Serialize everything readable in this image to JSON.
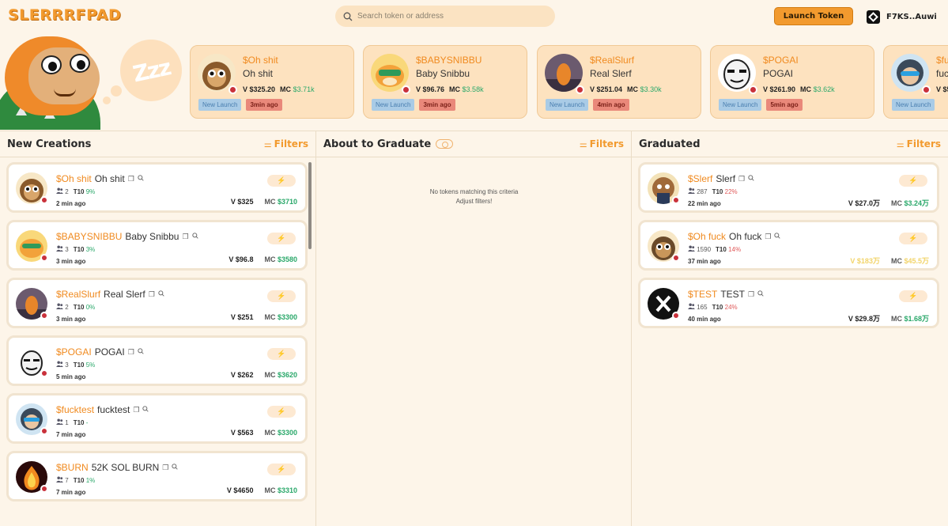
{
  "header": {
    "logo": "SLERRRFPAD",
    "search_placeholder": "Search token or address",
    "launch_label": "Launch Token",
    "wallet_label": "F7KS..Auwi"
  },
  "banner": {
    "zzz": "Zzz",
    "cards": [
      {
        "ticker": "$Oh shit",
        "name": "Oh shit",
        "vol": "V $325.20",
        "mc_label": "MC",
        "mc": "$3.71k",
        "tag": "New Launch",
        "time": "3min ago"
      },
      {
        "ticker": "$BABYSNIBBU",
        "name": "Baby Snibbu",
        "vol": "V $96.76",
        "mc_label": "MC",
        "mc": "$3.58k",
        "tag": "New Launch",
        "time": "3min ago"
      },
      {
        "ticker": "$RealSlurf",
        "name": "Real Slerf",
        "vol": "V $251.04",
        "mc_label": "MC",
        "mc": "$3.30k",
        "tag": "New Launch",
        "time": "4min ago"
      },
      {
        "ticker": "$POGAI",
        "name": "POGAI",
        "vol": "V $261.90",
        "mc_label": "MC",
        "mc": "$3.62k",
        "tag": "New Launch",
        "time": "5min ago"
      },
      {
        "ticker": "$fu",
        "name": "fuc",
        "vol": "V $5",
        "mc_label": "",
        "mc": "",
        "tag": "New Launch",
        "time": ""
      }
    ]
  },
  "columns": {
    "new": {
      "title": "New Creations",
      "filters": "Filters",
      "rows": [
        {
          "ticker": "$Oh shit",
          "name": "Oh shit",
          "holders": "2",
          "t10_label": "T10",
          "t10": "9%",
          "time": "2 min ago",
          "vol": "V $325",
          "mc_label": "MC",
          "mc": "$3710"
        },
        {
          "ticker": "$BABYSNIBBU",
          "name": "Baby Snibbu",
          "holders": "3",
          "t10_label": "T10",
          "t10": "3%",
          "time": "3 min ago",
          "vol": "V $96.8",
          "mc_label": "MC",
          "mc": "$3580"
        },
        {
          "ticker": "$RealSlurf",
          "name": "Real Slerf",
          "holders": "2",
          "t10_label": "T10",
          "t10": "0%",
          "time": "3 min ago",
          "vol": "V $251",
          "mc_label": "MC",
          "mc": "$3300"
        },
        {
          "ticker": "$POGAI",
          "name": "POGAI",
          "holders": "3",
          "t10_label": "T10",
          "t10": "5%",
          "time": "5 min ago",
          "vol": "V $262",
          "mc_label": "MC",
          "mc": "$3620"
        },
        {
          "ticker": "$fucktest",
          "name": "fucktest",
          "holders": "1",
          "t10_label": "T10",
          "t10": "-",
          "time": "7 min ago",
          "vol": "V $563",
          "mc_label": "MC",
          "mc": "$3300"
        },
        {
          "ticker": "$BURN",
          "name": "52K SOL BURN",
          "holders": "7",
          "t10_label": "T10",
          "t10": "1%",
          "time": "7 min ago",
          "vol": "V $4650",
          "mc_label": "MC",
          "mc": "$3310"
        }
      ]
    },
    "graduate": {
      "title": "About to Graduate",
      "filters": "Filters",
      "empty_line1": "No tokens matching this criteria",
      "empty_line2": "Adjust filters!"
    },
    "graduated": {
      "title": "Graduated",
      "filters": "Filters",
      "rows": [
        {
          "ticker": "$Slerf",
          "name": "Slerf",
          "holders": "287",
          "t10_label": "T10",
          "t10": "22%",
          "time": "22 min ago",
          "vol": "V $27.0万",
          "mc_label": "MC",
          "mc": "$3.24万"
        },
        {
          "ticker": "$Oh fuck",
          "name": "Oh fuck",
          "holders": "1590",
          "t10_label": "T10",
          "t10": "14%",
          "time": "37 min ago",
          "vol": "V $183万",
          "mc_label": "MC",
          "mc": "$45.5万"
        },
        {
          "ticker": "$TEST",
          "name": "TEST",
          "holders": "165",
          "t10_label": "T10",
          "t10": "24%",
          "time": "40 min ago",
          "vol": "V $29.8万",
          "mc_label": "MC",
          "mc": "$1.68万"
        }
      ]
    }
  },
  "icons": {
    "boost": "⚡",
    "copy": "❐",
    "search": "🔍",
    "users": "👥"
  },
  "colors": {
    "accent": "#f29a2e",
    "ticker": "#f08a1f",
    "positive": "#2aa86a",
    "negative": "#e05a5a",
    "background": "#fdf5e9"
  }
}
